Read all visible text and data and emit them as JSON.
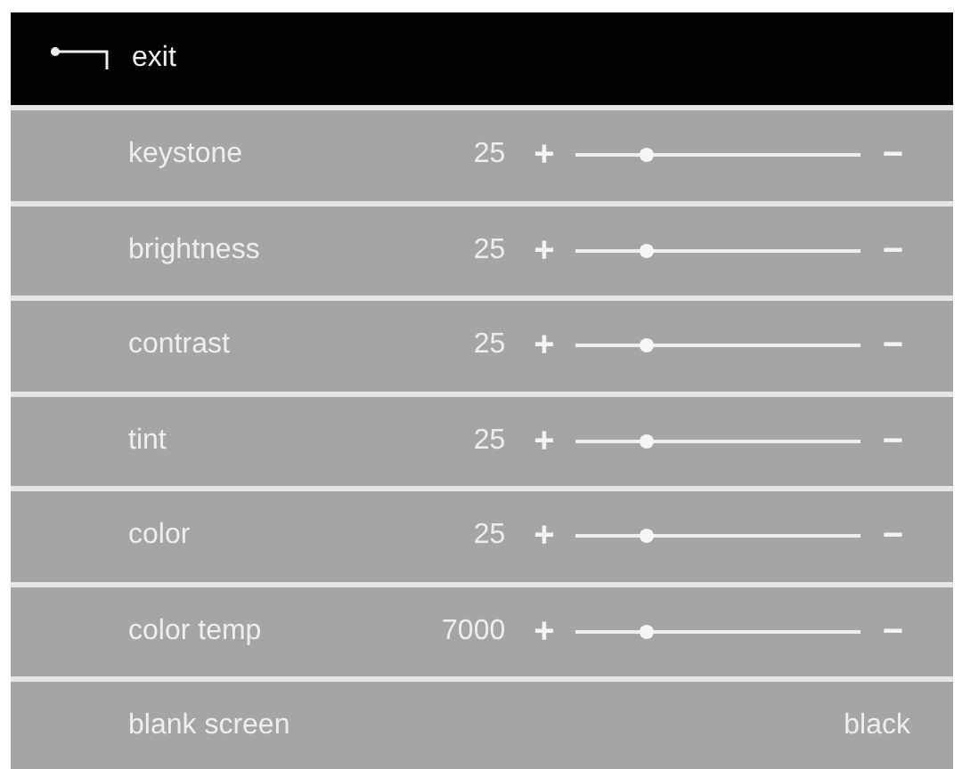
{
  "header": {
    "title": "exit"
  },
  "rows": [
    {
      "kind": "slider",
      "label": "keystone",
      "value": "25",
      "increase": "+",
      "decrease": "−",
      "level": 0.25
    },
    {
      "kind": "slider",
      "label": "brightness",
      "value": "25",
      "increase": "+",
      "decrease": "−",
      "level": 0.25
    },
    {
      "kind": "slider",
      "label": "contrast",
      "value": "25",
      "increase": "+",
      "decrease": "−",
      "level": 0.25
    },
    {
      "kind": "slider",
      "label": "tint",
      "value": "25",
      "increase": "+",
      "decrease": "−",
      "level": 0.25
    },
    {
      "kind": "slider",
      "label": "color",
      "value": "25",
      "increase": "+",
      "decrease": "−",
      "level": 0.25
    },
    {
      "kind": "slider",
      "label": "color temp",
      "value": "7000",
      "increase": "+",
      "decrease": "−",
      "level": 0.25
    },
    {
      "kind": "value",
      "label": "blank screen",
      "value": "black"
    }
  ]
}
